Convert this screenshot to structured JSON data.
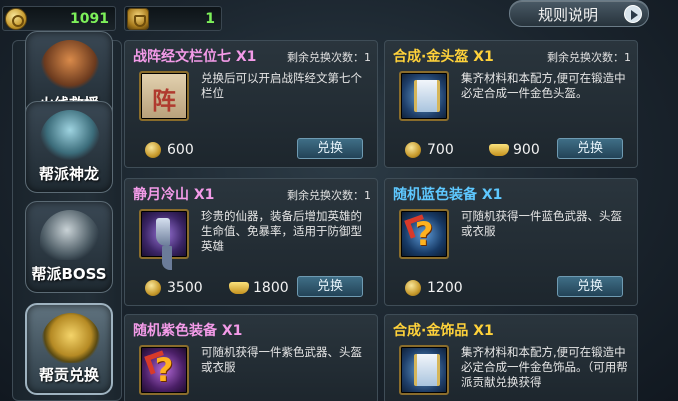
{
  "top": {
    "coins": "1091",
    "helmets": "1",
    "rules_label": "规则说明"
  },
  "sidebar": {
    "items": [
      {
        "label": "火线救援",
        "icon": "fire-rescue-icon"
      },
      {
        "label": "帮派神龙",
        "icon": "guild-dragon-icon"
      },
      {
        "label": "帮派BOSS",
        "icon": "guild-boss-icon"
      },
      {
        "label": "帮贡兑换",
        "icon": "guild-contribution-bag-icon",
        "active": true
      }
    ]
  },
  "items": [
    {
      "title": "战阵经文栏位七 X1",
      "title_color": "#f39be8",
      "remain": "剩余兑换次数：1",
      "icon": "zhen-scroll-icon",
      "icon_char": "阵",
      "desc": "兑换后可以开启战阵经文第七个栏位",
      "coin_cost": "600",
      "button": "兑换"
    },
    {
      "title": "合成·金头盔 X1",
      "title_color": "#ffd23a",
      "remain": "剩余兑换次数：1",
      "icon": "blueprint-scroll-icon",
      "desc": "集齐材料和本配方,便可在锻造中必定合成一件金色头盔。",
      "coin_cost": "700",
      "ingot_cost": "900",
      "button": "兑换"
    },
    {
      "title": "静月冷山 X1",
      "title_color": "#f39be8",
      "remain": "剩余兑换次数：1",
      "icon": "boot-icon",
      "desc": "珍贵的仙器，装备后增加英雄的生命值、免暴率，适用于防御型英雄",
      "coin_cost": "3500",
      "ingot_cost": "1800",
      "button": "兑换"
    },
    {
      "title": "随机蓝色装备 X1",
      "title_color": "#5ec8ff",
      "icon": "random-blue-equip-icon",
      "icon_char": "?",
      "desc": "可随机获得一件蓝色武器、头盔或衣服",
      "coin_cost": "1200",
      "button": "兑换"
    },
    {
      "title": "随机紫色装备 X1",
      "title_color": "#f39be8",
      "icon": "random-purple-equip-icon",
      "icon_char": "?",
      "desc": "可随机获得一件紫色武器、头盔或衣服"
    },
    {
      "title": "合成·金饰品 X1",
      "title_color": "#ffd23a",
      "icon": "blueprint-scroll-icon",
      "desc": "集齐材料和本配方,便可在锻造中必定合成一件金色饰品。（可用帮派贡献兑换获得"
    }
  ]
}
